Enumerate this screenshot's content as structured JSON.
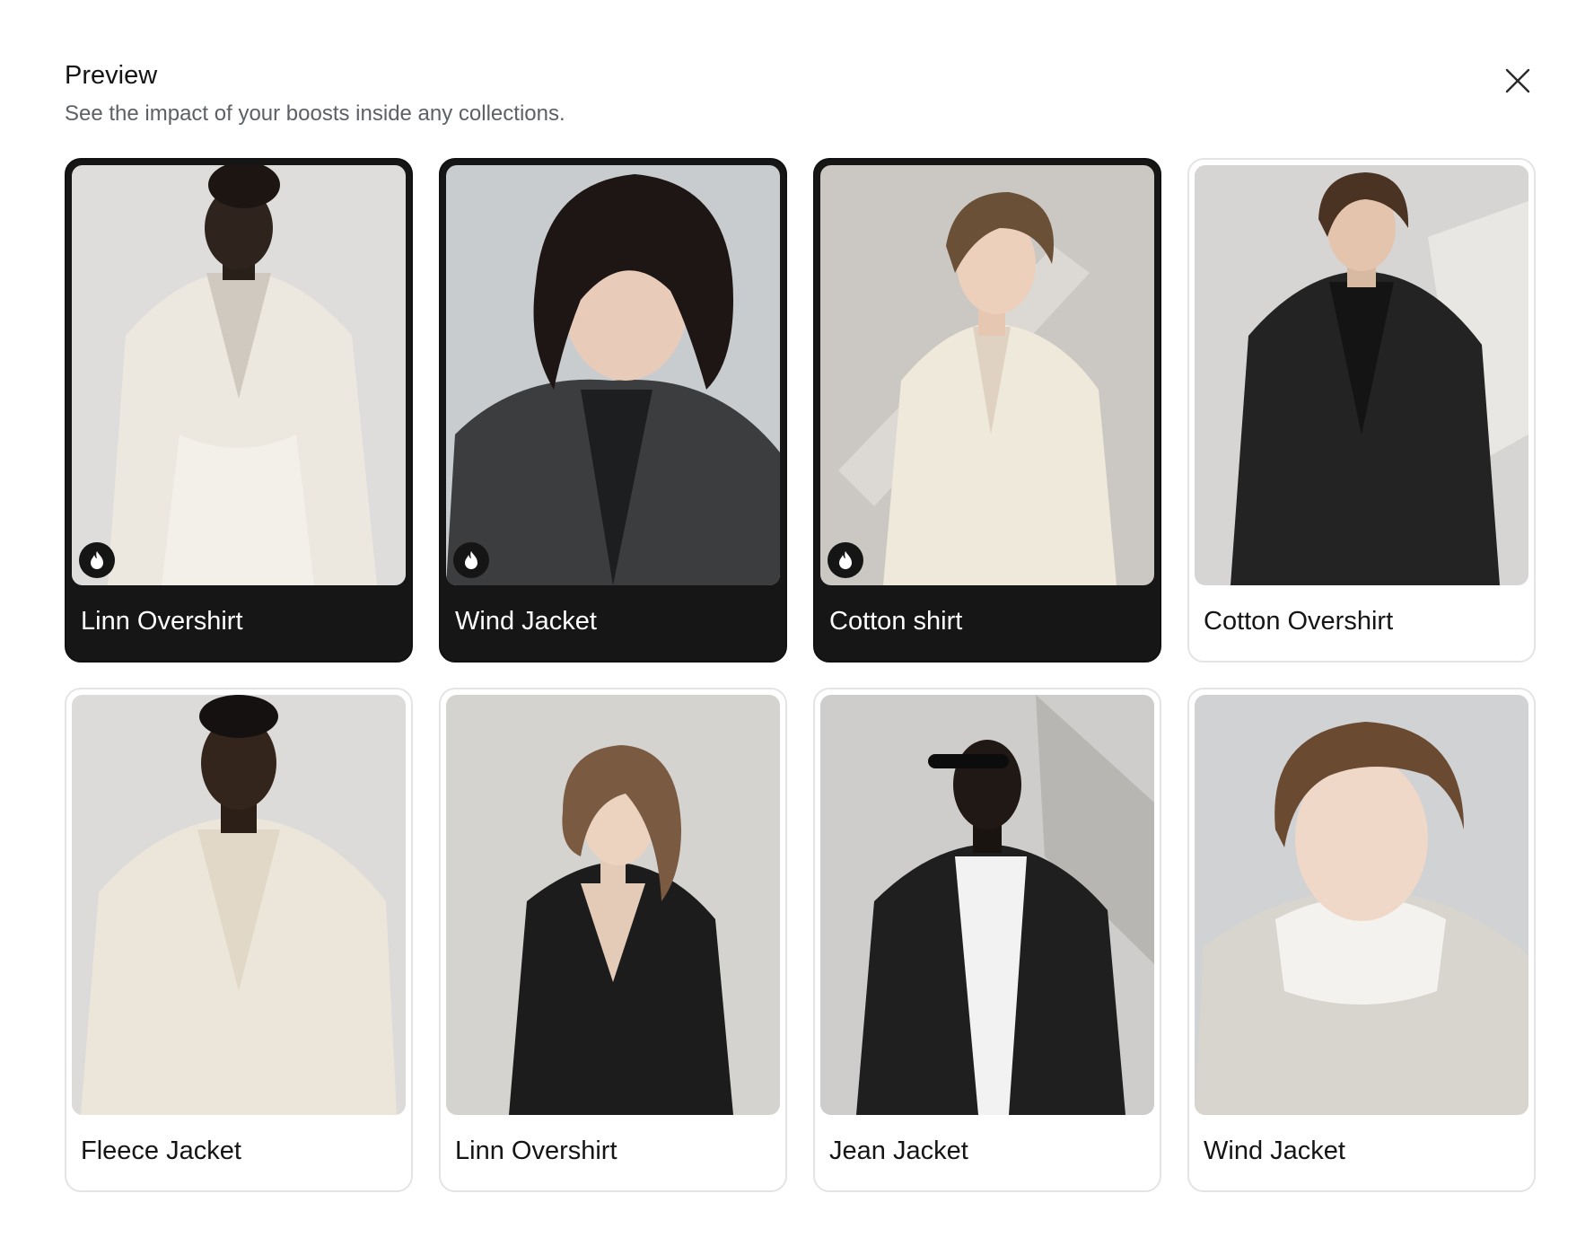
{
  "modal": {
    "title": "Preview",
    "subtitle": "See the impact of your boosts inside any collections.",
    "close_icon": "close-icon"
  },
  "products": [
    {
      "name": "Linn Overshirt",
      "boosted": true,
      "boost_icon": "flame-icon"
    },
    {
      "name": "Wind Jacket",
      "boosted": true,
      "boost_icon": "flame-icon"
    },
    {
      "name": "Cotton shirt",
      "boosted": true,
      "boost_icon": "flame-icon"
    },
    {
      "name": "Cotton Overshirt",
      "boosted": false
    },
    {
      "name": "Fleece Jacket",
      "boosted": false
    },
    {
      "name": "Linn Overshirt",
      "boosted": false
    },
    {
      "name": "Jean Jacket",
      "boosted": false
    },
    {
      "name": "Wind Jacket",
      "boosted": false
    }
  ],
  "colors": {
    "boosted_card_bg": "#161616",
    "card_border": "#e4e4e6",
    "subtitle_text": "#5d6166"
  }
}
